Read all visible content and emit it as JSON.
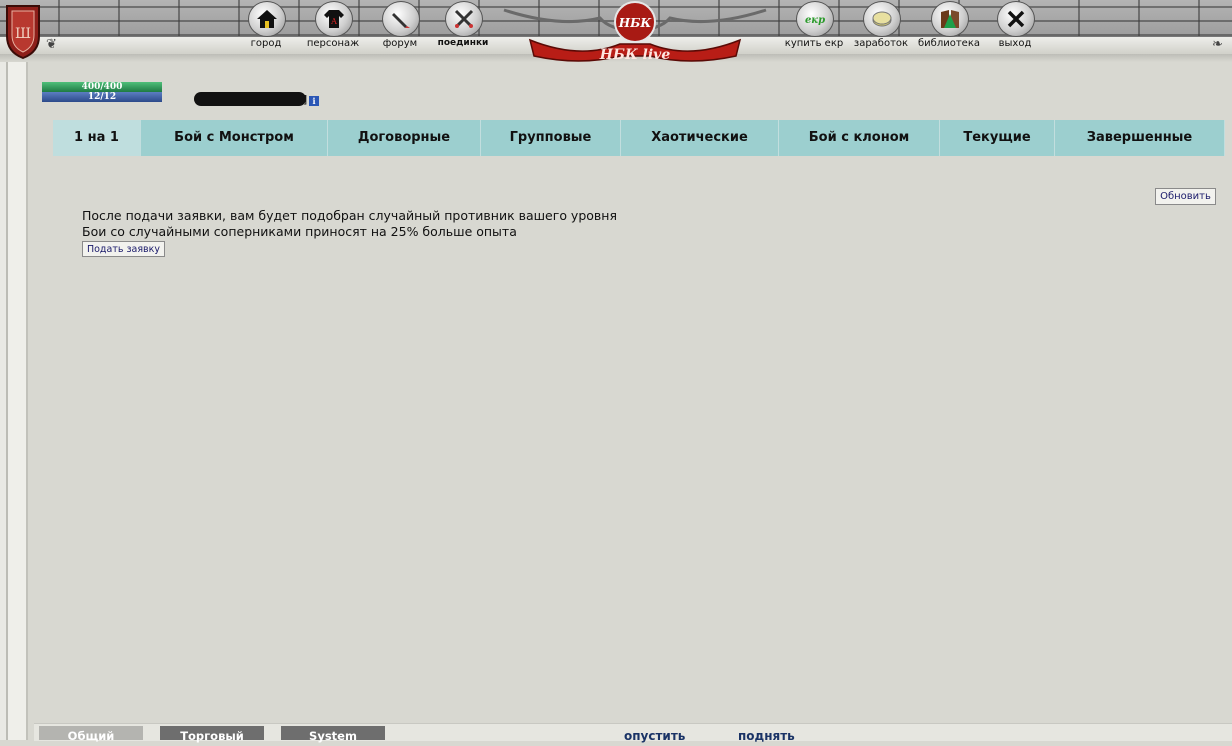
{
  "nav": {
    "left": [
      {
        "name": "city",
        "label": "город",
        "icon": "house-icon"
      },
      {
        "name": "character",
        "label": "персонаж",
        "icon": "shirt-icon"
      },
      {
        "name": "forum",
        "label": "форум",
        "icon": "pencil-icon"
      },
      {
        "name": "duels",
        "label": "поединки",
        "icon": "crossed-swords-icon"
      }
    ],
    "right": [
      {
        "name": "buy-ekr",
        "label": "купить екр",
        "icon": "ekr-icon"
      },
      {
        "name": "earnings",
        "label": "заработок",
        "icon": "coin-icon"
      },
      {
        "name": "library",
        "label": "библиотека",
        "icon": "library-icon"
      },
      {
        "name": "exit",
        "label": "выход",
        "icon": "x-icon"
      }
    ],
    "logo_text": "НБК",
    "logo_sub": "НБК live"
  },
  "player": {
    "hp": "400/400",
    "mana": "12/12",
    "hp_fraction": 1.0,
    "mana_fraction": 1.0
  },
  "tabs": [
    {
      "label": "1 на 1",
      "active": true
    },
    {
      "label": "Бой с Монстром",
      "active": false
    },
    {
      "label": "Договорные",
      "active": false
    },
    {
      "label": "Групповые",
      "active": false
    },
    {
      "label": "Хаотические",
      "active": false
    },
    {
      "label": "Бой с клоном",
      "active": false
    },
    {
      "label": "Текущие",
      "active": false
    },
    {
      "label": "Завершенные",
      "active": false
    }
  ],
  "content": {
    "refresh_label": "Обновить",
    "line1": "После подачи заявки, вам будет подобран случайный противник вашего уровня",
    "line2": "Бои со случайными соперниками приносят на 25% больше опыта",
    "submit_label": "Подать заявку"
  },
  "chat": {
    "tabs": [
      {
        "label": "Общий",
        "color": "#b4b4b0"
      },
      {
        "label": "Торговый",
        "color": "#6e6e6e"
      },
      {
        "label": "System",
        "color": "#6e6e6e"
      }
    ],
    "lower_label": "опустить",
    "raise_label": "поднять"
  },
  "colors": {
    "tab_bg": "#9ccfcf",
    "tab_active": "#bfdede",
    "logo_red": "#c0231c"
  }
}
